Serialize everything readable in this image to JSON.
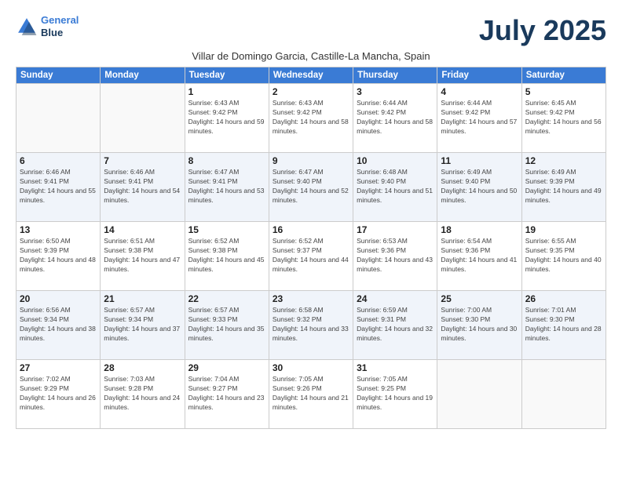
{
  "logo": {
    "line1": "General",
    "line2": "Blue"
  },
  "title": "July 2025",
  "subtitle": "Villar de Domingo Garcia, Castille-La Mancha, Spain",
  "days_of_week": [
    "Sunday",
    "Monday",
    "Tuesday",
    "Wednesday",
    "Thursday",
    "Friday",
    "Saturday"
  ],
  "weeks": [
    [
      {
        "day": "",
        "info": ""
      },
      {
        "day": "",
        "info": ""
      },
      {
        "day": "1",
        "info": "Sunrise: 6:43 AM\nSunset: 9:42 PM\nDaylight: 14 hours and 59 minutes."
      },
      {
        "day": "2",
        "info": "Sunrise: 6:43 AM\nSunset: 9:42 PM\nDaylight: 14 hours and 58 minutes."
      },
      {
        "day": "3",
        "info": "Sunrise: 6:44 AM\nSunset: 9:42 PM\nDaylight: 14 hours and 58 minutes."
      },
      {
        "day": "4",
        "info": "Sunrise: 6:44 AM\nSunset: 9:42 PM\nDaylight: 14 hours and 57 minutes."
      },
      {
        "day": "5",
        "info": "Sunrise: 6:45 AM\nSunset: 9:42 PM\nDaylight: 14 hours and 56 minutes."
      }
    ],
    [
      {
        "day": "6",
        "info": "Sunrise: 6:46 AM\nSunset: 9:41 PM\nDaylight: 14 hours and 55 minutes."
      },
      {
        "day": "7",
        "info": "Sunrise: 6:46 AM\nSunset: 9:41 PM\nDaylight: 14 hours and 54 minutes."
      },
      {
        "day": "8",
        "info": "Sunrise: 6:47 AM\nSunset: 9:41 PM\nDaylight: 14 hours and 53 minutes."
      },
      {
        "day": "9",
        "info": "Sunrise: 6:47 AM\nSunset: 9:40 PM\nDaylight: 14 hours and 52 minutes."
      },
      {
        "day": "10",
        "info": "Sunrise: 6:48 AM\nSunset: 9:40 PM\nDaylight: 14 hours and 51 minutes."
      },
      {
        "day": "11",
        "info": "Sunrise: 6:49 AM\nSunset: 9:40 PM\nDaylight: 14 hours and 50 minutes."
      },
      {
        "day": "12",
        "info": "Sunrise: 6:49 AM\nSunset: 9:39 PM\nDaylight: 14 hours and 49 minutes."
      }
    ],
    [
      {
        "day": "13",
        "info": "Sunrise: 6:50 AM\nSunset: 9:39 PM\nDaylight: 14 hours and 48 minutes."
      },
      {
        "day": "14",
        "info": "Sunrise: 6:51 AM\nSunset: 9:38 PM\nDaylight: 14 hours and 47 minutes."
      },
      {
        "day": "15",
        "info": "Sunrise: 6:52 AM\nSunset: 9:38 PM\nDaylight: 14 hours and 45 minutes."
      },
      {
        "day": "16",
        "info": "Sunrise: 6:52 AM\nSunset: 9:37 PM\nDaylight: 14 hours and 44 minutes."
      },
      {
        "day": "17",
        "info": "Sunrise: 6:53 AM\nSunset: 9:36 PM\nDaylight: 14 hours and 43 minutes."
      },
      {
        "day": "18",
        "info": "Sunrise: 6:54 AM\nSunset: 9:36 PM\nDaylight: 14 hours and 41 minutes."
      },
      {
        "day": "19",
        "info": "Sunrise: 6:55 AM\nSunset: 9:35 PM\nDaylight: 14 hours and 40 minutes."
      }
    ],
    [
      {
        "day": "20",
        "info": "Sunrise: 6:56 AM\nSunset: 9:34 PM\nDaylight: 14 hours and 38 minutes."
      },
      {
        "day": "21",
        "info": "Sunrise: 6:57 AM\nSunset: 9:34 PM\nDaylight: 14 hours and 37 minutes."
      },
      {
        "day": "22",
        "info": "Sunrise: 6:57 AM\nSunset: 9:33 PM\nDaylight: 14 hours and 35 minutes."
      },
      {
        "day": "23",
        "info": "Sunrise: 6:58 AM\nSunset: 9:32 PM\nDaylight: 14 hours and 33 minutes."
      },
      {
        "day": "24",
        "info": "Sunrise: 6:59 AM\nSunset: 9:31 PM\nDaylight: 14 hours and 32 minutes."
      },
      {
        "day": "25",
        "info": "Sunrise: 7:00 AM\nSunset: 9:30 PM\nDaylight: 14 hours and 30 minutes."
      },
      {
        "day": "26",
        "info": "Sunrise: 7:01 AM\nSunset: 9:30 PM\nDaylight: 14 hours and 28 minutes."
      }
    ],
    [
      {
        "day": "27",
        "info": "Sunrise: 7:02 AM\nSunset: 9:29 PM\nDaylight: 14 hours and 26 minutes."
      },
      {
        "day": "28",
        "info": "Sunrise: 7:03 AM\nSunset: 9:28 PM\nDaylight: 14 hours and 24 minutes."
      },
      {
        "day": "29",
        "info": "Sunrise: 7:04 AM\nSunset: 9:27 PM\nDaylight: 14 hours and 23 minutes."
      },
      {
        "day": "30",
        "info": "Sunrise: 7:05 AM\nSunset: 9:26 PM\nDaylight: 14 hours and 21 minutes."
      },
      {
        "day": "31",
        "info": "Sunrise: 7:05 AM\nSunset: 9:25 PM\nDaylight: 14 hours and 19 minutes."
      },
      {
        "day": "",
        "info": ""
      },
      {
        "day": "",
        "info": ""
      }
    ]
  ]
}
